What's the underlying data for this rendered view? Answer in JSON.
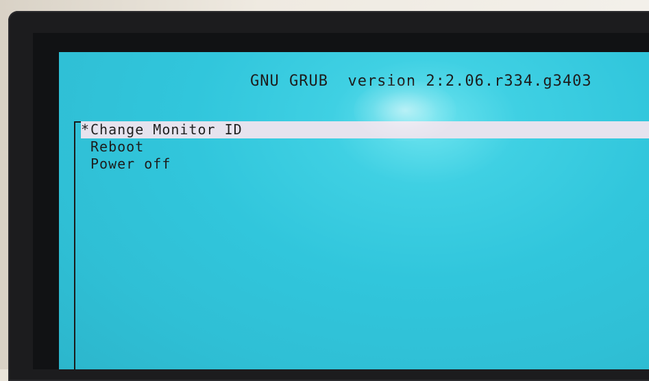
{
  "header": {
    "title": "GNU GRUB  version 2:2.06.r334.g3403"
  },
  "menu": {
    "selected_marker": "*",
    "items": [
      {
        "label": "Change Monitor ID",
        "selected": true
      },
      {
        "label": "Reboot",
        "selected": false
      },
      {
        "label": "Power off",
        "selected": false
      }
    ]
  },
  "colors": {
    "screen_background": "#31c6dc",
    "highlight_background": "#e6e3ee",
    "text": "#1d1d1d",
    "bezel": "#1c1c1e"
  }
}
